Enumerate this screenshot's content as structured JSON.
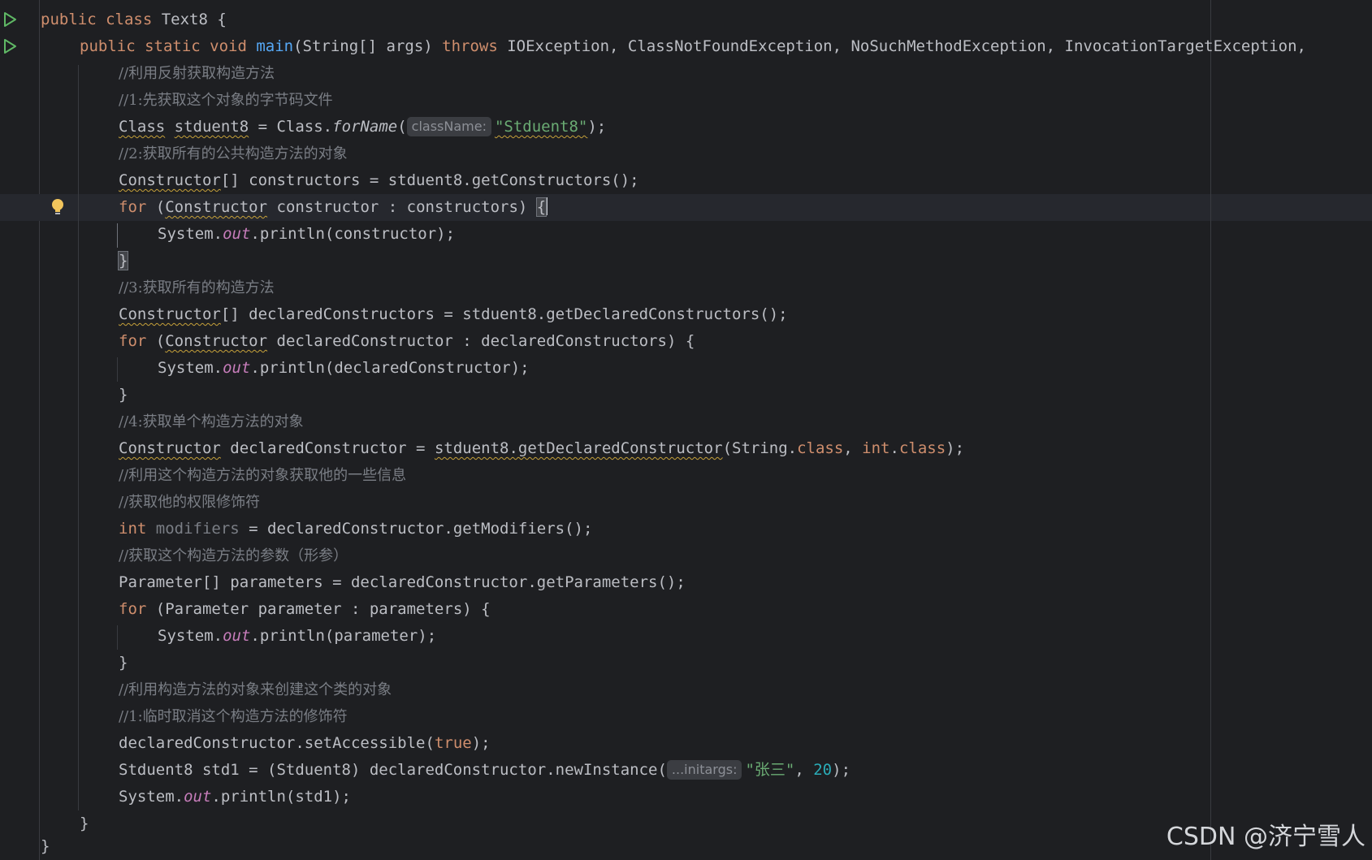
{
  "code": {
    "l1": {
      "kw": "public class ",
      "name": "Text8",
      "rest": " {"
    },
    "l2": {
      "kw": "public static void ",
      "fn": "main",
      "args": "(String[] args) ",
      "throws": "throws",
      "exc": " IOException, ClassNotFoundException, NoSuchMethodException, InvocationTargetException,"
    },
    "l3": {
      "cmt": "//利用反射获取构造方法"
    },
    "l4": {
      "cmt": "//1:先获取这个对象的字节码文件"
    },
    "l5": {
      "type": "Class",
      "var": "stduent8",
      "mid": " = Class.",
      "call": "forName",
      "open": "(",
      "hint": "className:",
      "str": "\"Stduent8\"",
      "close": ");"
    },
    "l6": {
      "cmt": "//2:获取所有的公共构造方法的对象"
    },
    "l7": {
      "type": "Constructor",
      "rest": "[] constructors = stduent8.getConstructors();"
    },
    "l8": {
      "kw": "for",
      "open": " (",
      "type": "Constructor",
      "rest": " constructor : constructors) ",
      "brace": "{"
    },
    "l9": {
      "pre": "System.",
      "field": "out",
      "rest": ".println(constructor);"
    },
    "l10": {
      "brace": "}"
    },
    "l11": {
      "cmt": "//3:获取所有的构造方法"
    },
    "l12": {
      "type": "Constructor",
      "rest": "[] declaredConstructors = stduent8.getDeclaredConstructors();"
    },
    "l13": {
      "kw": "for",
      "open": " (",
      "type": "Constructor",
      "rest": " declaredConstructor : declaredConstructors) {"
    },
    "l14": {
      "pre": "System.",
      "field": "out",
      "rest": ".println(declaredConstructor);"
    },
    "l15": {
      "text": "}"
    },
    "l16": {
      "cmt": "//4:获取单个构造方法的对象"
    },
    "l17": {
      "type": "Constructor",
      "mid": " declaredConstructor = ",
      "warn": "stduent8.getDeclaredConstructor",
      "args": "(String.",
      "kw1": "class",
      "comma": ", ",
      "kw2": "int",
      "dot": ".",
      "kw3": "class",
      "close": ");"
    },
    "l18": {
      "cmt": "//利用这个构造方法的对象获取他的一些信息"
    },
    "l19": {
      "cmt": "//获取他的权限修饰符"
    },
    "l20": {
      "kw": "int",
      "sp": " ",
      "unused": "modifiers",
      "rest": " = declaredConstructor.getModifiers();"
    },
    "l21": {
      "cmt": "//获取这个构造方法的参数（形参）"
    },
    "l22": {
      "text": "Parameter[] parameters = declaredConstructor.getParameters();"
    },
    "l23": {
      "kw": "for",
      "rest": " (Parameter parameter : parameters) {"
    },
    "l24": {
      "pre": "System.",
      "field": "out",
      "rest": ".println(parameter);"
    },
    "l25": {
      "text": "}"
    },
    "l26": {
      "cmt": "//利用构造方法的对象来创建这个类的对象"
    },
    "l27": {
      "cmt": "//1:临时取消这个构造方法的修饰符"
    },
    "l28": {
      "pre": "declaredConstructor.setAccessible(",
      "kw": "true",
      "rest": ");"
    },
    "l29": {
      "pre": "Stduent8 std1 = (Stduent8) declaredConstructor.newInstance(",
      "hint": "...initargs:",
      "str": "\"张三\"",
      "comma": ", ",
      "num": "20",
      "rest": ");"
    },
    "l30": {
      "pre": "System.",
      "field": "out",
      "rest": ".println(std1);"
    },
    "l31": {
      "text": "}"
    },
    "l32": {
      "text": "}"
    }
  },
  "icons": {
    "run": "run-gutter-icon",
    "bulb": "intention-bulb-icon"
  },
  "colors": {
    "background": "#1e1f22",
    "keyword": "#cf8e6d",
    "function": "#56a8f5",
    "string": "#6aab73",
    "number": "#2aacb8",
    "comment": "#7a7e85",
    "static_field": "#c77dbb"
  },
  "watermark": "CSDN @济宁雪人"
}
